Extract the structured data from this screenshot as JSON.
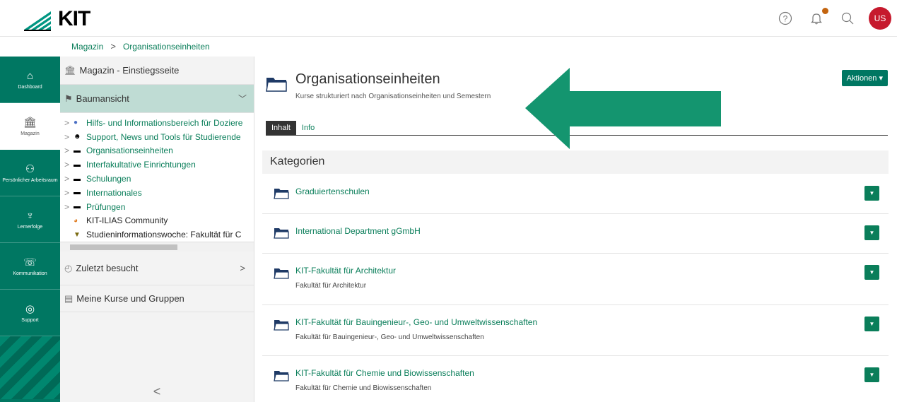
{
  "app": {
    "logo_text": "KIT",
    "avatar_initials": "US",
    "accent_color": "#007762",
    "link_color": "#0a7e5a"
  },
  "breadcrumb": [
    "Magazin",
    "Organisationseinheiten"
  ],
  "mainbar": {
    "items": [
      {
        "label": "Dashboard",
        "icon": "dashboard-icon"
      },
      {
        "label": "Magazin",
        "icon": "repository-icon"
      },
      {
        "label": "Persönlicher Arbeitsraum",
        "icon": "person-icon"
      },
      {
        "label": "Lernerfolge",
        "icon": "trophy-icon"
      },
      {
        "label": "Kommunikation",
        "icon": "chat-icon"
      },
      {
        "label": "Support",
        "icon": "lifebuoy-icon"
      }
    ]
  },
  "slate": {
    "entry_home": "Magazin - Einstiegsseite",
    "entry_tree": "Baumansicht",
    "tree": [
      {
        "label": "Hilfs- und Informationsbereich für Doziere",
        "icon": "help-icon",
        "expandable": true
      },
      {
        "label": "Support, News und Tools für Studierende",
        "icon": "support-icon",
        "expandable": true
      },
      {
        "label": "Organisationseinheiten",
        "icon": "folder-icon",
        "expandable": true
      },
      {
        "label": "Interfakultative Einrichtungen",
        "icon": "folder-icon",
        "expandable": true
      },
      {
        "label": "Schulungen",
        "icon": "folder-icon",
        "expandable": true
      },
      {
        "label": "Internationales",
        "icon": "folder-icon",
        "expandable": true
      },
      {
        "label": "Prüfungen",
        "icon": "folder-icon",
        "expandable": true
      },
      {
        "label": "KIT-ILIAS Community",
        "icon": "community-icon",
        "expandable": false
      },
      {
        "label": "Studieninformationswoche: Fakultät für C",
        "icon": "course-icon",
        "expandable": false
      }
    ],
    "entry_recent": "Zuletzt besucht",
    "entry_courses": "Meine Kurse und Gruppen"
  },
  "content": {
    "title": "Organisationseinheiten",
    "description": "Kurse strukturiert nach Organisationseinheiten und Semestern",
    "actions_label": "Aktionen ▾",
    "tabs": [
      "Inhalt",
      "Info"
    ],
    "panel_title": "Kategorien",
    "categories": [
      {
        "title": "Graduiertenschulen",
        "desc": ""
      },
      {
        "title": "International Department gGmbH",
        "desc": ""
      },
      {
        "title": "KIT-Fakultät für Architektur",
        "desc": "Fakultät für Architektur"
      },
      {
        "title": "KIT-Fakultät für Bauingenieur-, Geo- und Umweltwissenschaften",
        "desc": "Fakultät für Bauingenieur-, Geo- und Umweltwissenschaften"
      },
      {
        "title": "KIT-Fakultät für Chemie und Biowissenschaften",
        "desc": "Fakultät für Chemie und Biowissenschaften"
      }
    ]
  }
}
